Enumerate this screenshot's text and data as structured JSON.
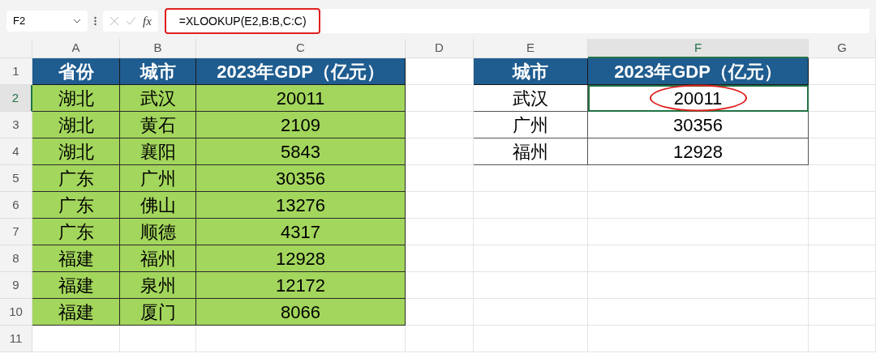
{
  "formula_bar": {
    "name_box": "F2",
    "fx_label": "fx",
    "formula": "=XLOOKUP(E2,B:B,C:C)",
    "highlighted": true
  },
  "column_headers": [
    {
      "label": "A",
      "selected": false
    },
    {
      "label": "B",
      "selected": false
    },
    {
      "label": "C",
      "selected": false
    },
    {
      "label": "D",
      "selected": false
    },
    {
      "label": "E",
      "selected": false
    },
    {
      "label": "F",
      "selected": true
    },
    {
      "label": "G",
      "selected": false
    }
  ],
  "row_headers": [
    {
      "label": "1",
      "selected": false
    },
    {
      "label": "2",
      "selected": true
    },
    {
      "label": "3",
      "selected": false
    },
    {
      "label": "4",
      "selected": false
    },
    {
      "label": "5",
      "selected": false
    },
    {
      "label": "6",
      "selected": false
    },
    {
      "label": "7",
      "selected": false
    },
    {
      "label": "8",
      "selected": false
    },
    {
      "label": "9",
      "selected": false
    },
    {
      "label": "10",
      "selected": false
    },
    {
      "label": "11",
      "selected": false
    }
  ],
  "source_table": {
    "columns": [
      "省份",
      "城市",
      "2023年GDP（亿元）"
    ],
    "rows": [
      [
        "湖北",
        "武汉",
        "20011"
      ],
      [
        "湖北",
        "黄石",
        "2109"
      ],
      [
        "湖北",
        "襄阳",
        "5843"
      ],
      [
        "广东",
        "广州",
        "30356"
      ],
      [
        "广东",
        "佛山",
        "13276"
      ],
      [
        "广东",
        "顺德",
        "4317"
      ],
      [
        "福建",
        "福州",
        "12928"
      ],
      [
        "福建",
        "泉州",
        "12172"
      ],
      [
        "福建",
        "厦门",
        "8066"
      ]
    ]
  },
  "lookup_table": {
    "columns": [
      "城市",
      "2023年GDP（亿元）"
    ],
    "rows": [
      {
        "cells": [
          "武汉",
          "20011"
        ],
        "selected": true,
        "circled": true
      },
      {
        "cells": [
          "广州",
          "30356"
        ],
        "selected": false,
        "circled": false
      },
      {
        "cells": [
          "福州",
          "12928"
        ],
        "selected": false,
        "circled": false
      }
    ]
  }
}
